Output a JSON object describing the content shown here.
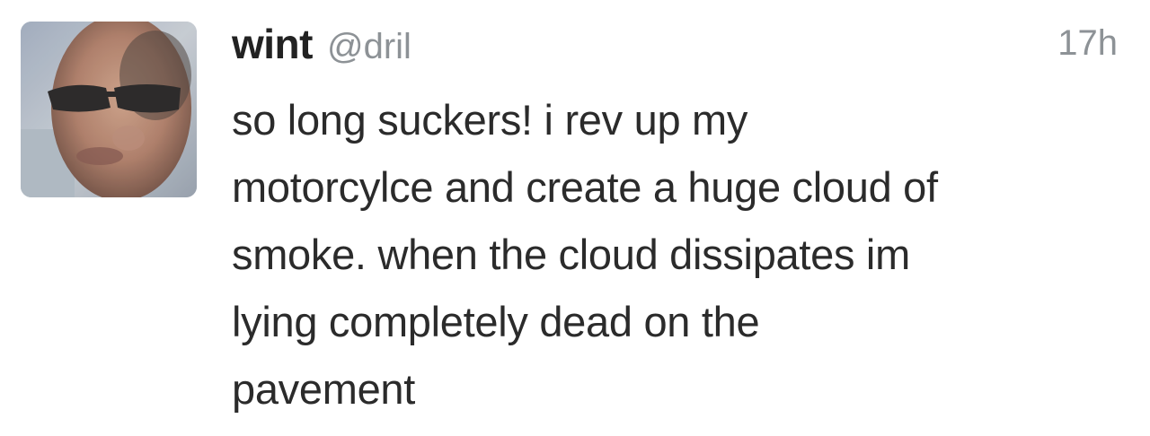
{
  "tweet": {
    "display_name": "wint",
    "handle": "@dril",
    "timestamp": "17h",
    "text": "so long suckers! i rev up my\nmotorcylce and create a huge cloud of\nsmoke. when the cloud dissipates im\nlying completely dead on the\npavement",
    "avatar_icon": "profile-photo"
  },
  "colors": {
    "name": "#222222",
    "handle": "#8d9296",
    "text": "#2b2b2b",
    "background": "#ffffff"
  }
}
